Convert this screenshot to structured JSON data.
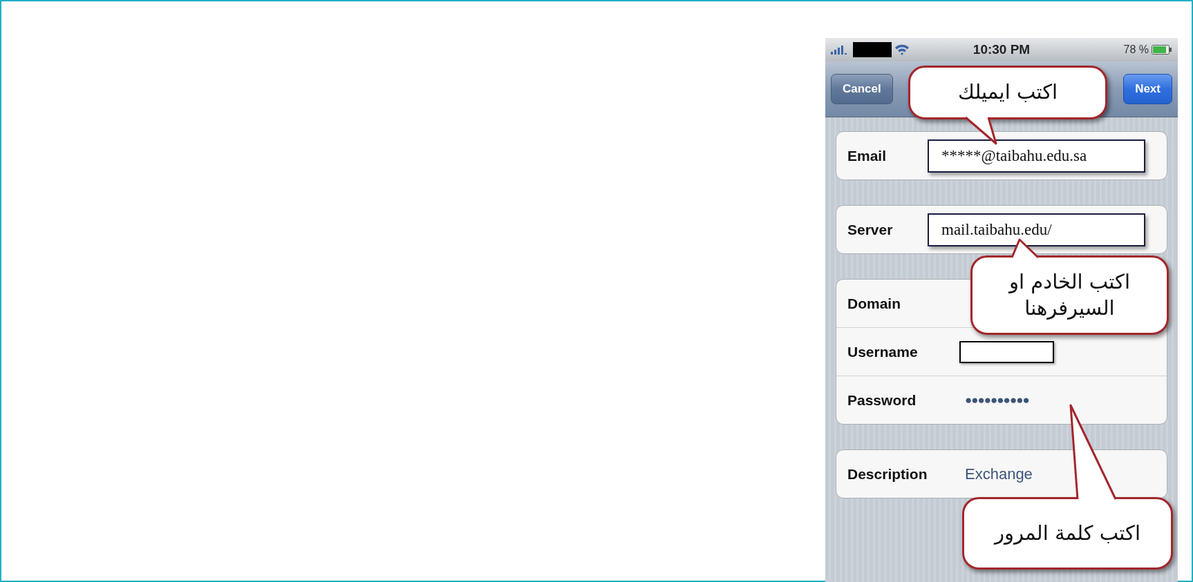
{
  "status_bar": {
    "time": "10:30 PM",
    "battery": "78 %"
  },
  "nav": {
    "buttons": [
      {
        "label": "Cancel",
        "kind": "plain"
      },
      {
        "label": "Next",
        "kind": "primary"
      }
    ]
  },
  "groups": [
    {
      "fields": [
        {
          "label": "Email",
          "kind": "boxed",
          "value": "*****@taibahu.edu.sa"
        }
      ]
    },
    {
      "fields": [
        {
          "label": "Server",
          "kind": "boxed",
          "value": "mail.taibahu.edu/"
        }
      ]
    },
    {
      "fields": [
        {
          "label": "Domain",
          "kind": "empty"
        },
        {
          "label": "Username",
          "kind": "redacted"
        },
        {
          "label": "Password",
          "kind": "secure",
          "value": "●●●●●●●●●●"
        }
      ]
    },
    {
      "fields": [
        {
          "label": "Description",
          "kind": "text",
          "value": "Exchange"
        }
      ]
    }
  ],
  "callouts": [
    {
      "text": "اكتب ايميلك"
    },
    {
      "text": "اكتب الخادم او السيرفرهنا"
    },
    {
      "text": "اكتب كلمة المرور"
    }
  ]
}
